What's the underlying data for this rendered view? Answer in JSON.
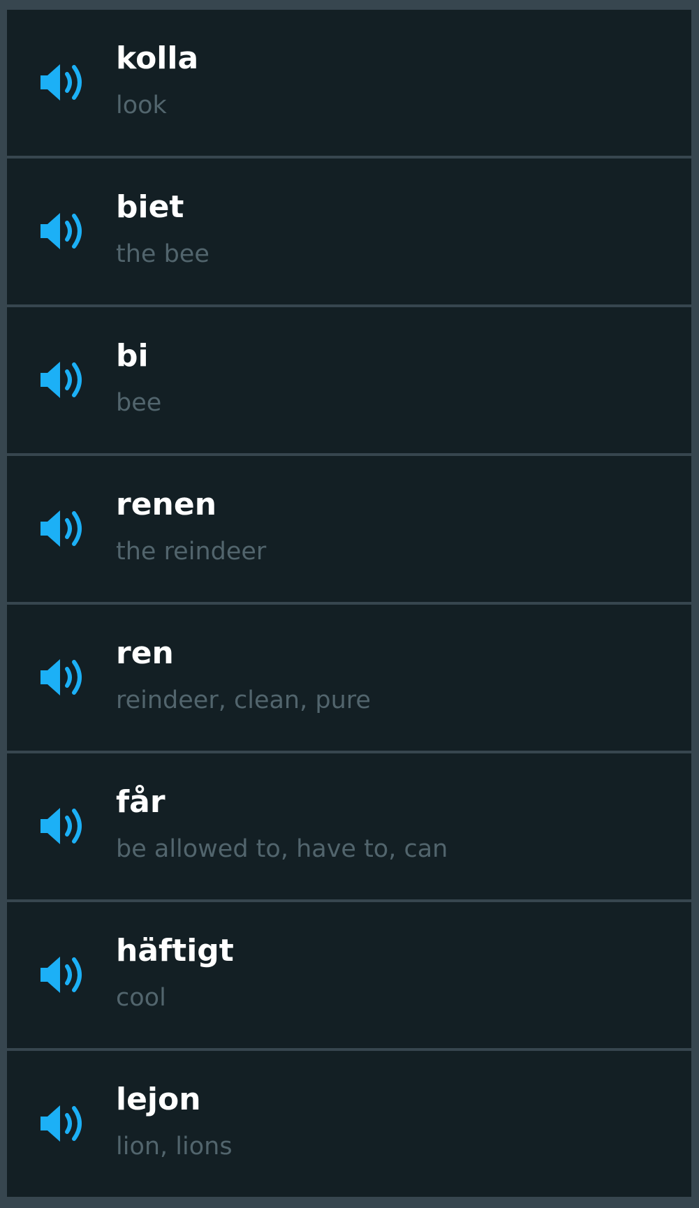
{
  "accent_color": "#1cb0f6",
  "icon": "speaker-volume-icon",
  "words": [
    {
      "word": "kolla",
      "meaning": "look"
    },
    {
      "word": "biet",
      "meaning": "the bee"
    },
    {
      "word": "bi",
      "meaning": "bee"
    },
    {
      "word": "renen",
      "meaning": "the reindeer"
    },
    {
      "word": "ren",
      "meaning": "reindeer, clean, pure"
    },
    {
      "word": "får",
      "meaning": "be allowed to, have to, can"
    },
    {
      "word": "häftigt",
      "meaning": "cool"
    },
    {
      "word": "lejon",
      "meaning": "lion, lions"
    }
  ]
}
